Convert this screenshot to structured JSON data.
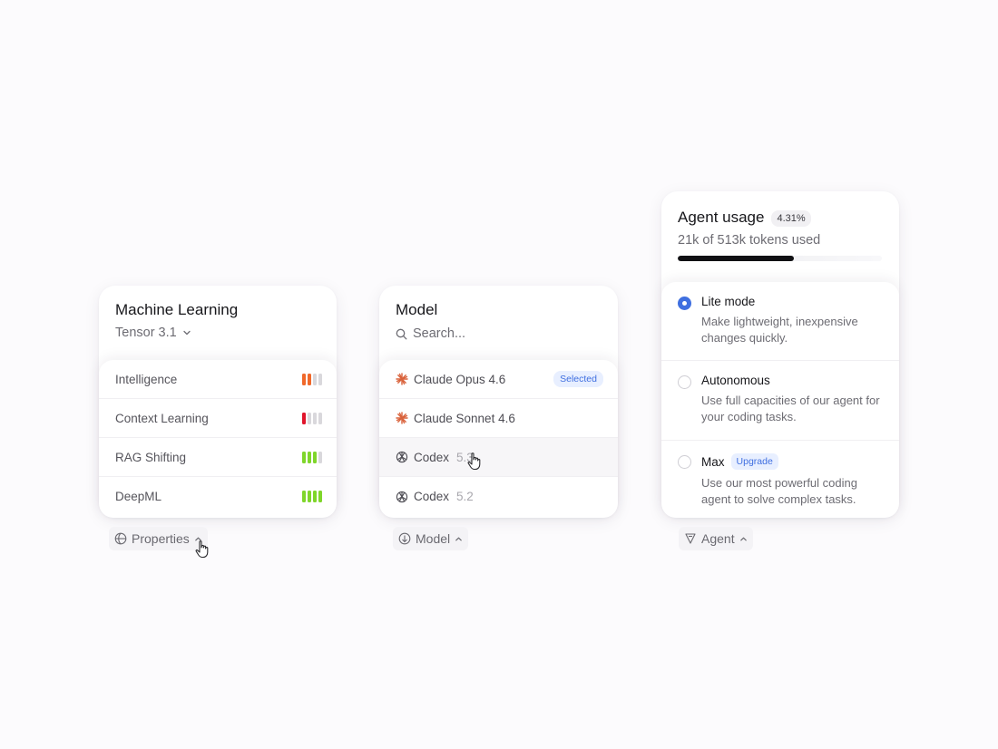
{
  "properties_card": {
    "title": "Machine Learning",
    "version_label": "Tensor 3.1",
    "rows": [
      {
        "label": "Intelligence",
        "level": 2,
        "color": "#f0682a"
      },
      {
        "label": "Context Learning",
        "level": 1,
        "color": "#e0152b"
      },
      {
        "label": "RAG Shifting",
        "level": 3,
        "color": "#7fd62a"
      },
      {
        "label": "DeepML",
        "level": 4,
        "color": "#7fd62a"
      }
    ]
  },
  "model_card": {
    "title": "Model",
    "search_placeholder": "Search...",
    "items": [
      {
        "name": "Claude Opus 4.6",
        "version": "",
        "icon": "claude-icon",
        "badge": "Selected"
      },
      {
        "name": "Claude Sonnet 4.6",
        "version": "",
        "icon": "claude-icon",
        "badge": ""
      },
      {
        "name": "Codex",
        "version": "5.3",
        "icon": "openai-icon",
        "badge": ""
      },
      {
        "name": "Codex",
        "version": "5.2",
        "icon": "openai-icon",
        "badge": ""
      }
    ]
  },
  "agent_card": {
    "title": "Agent usage",
    "usage_percent_label": "4.31%",
    "usage_text": "21k of 513k tokens used",
    "usage_fraction": 0.57,
    "options": [
      {
        "title": "Lite mode",
        "badge": "",
        "description": "Make lightweight, inexpensive changes quickly.",
        "selected": true
      },
      {
        "title": "Autonomous",
        "badge": "",
        "description": "Use full capacities of our agent for your coding tasks.",
        "selected": false
      },
      {
        "title": "Max",
        "badge": "Upgrade",
        "description": "Use our most powerful coding agent to solve complex tasks.",
        "selected": false
      }
    ]
  },
  "triggers": {
    "properties": "Properties",
    "model": "Model",
    "agent": "Agent"
  },
  "colors": {
    "accent": "#3f6fe0",
    "claude_icon": "#d9623b",
    "inactive_bar": "#d9d8dc"
  }
}
